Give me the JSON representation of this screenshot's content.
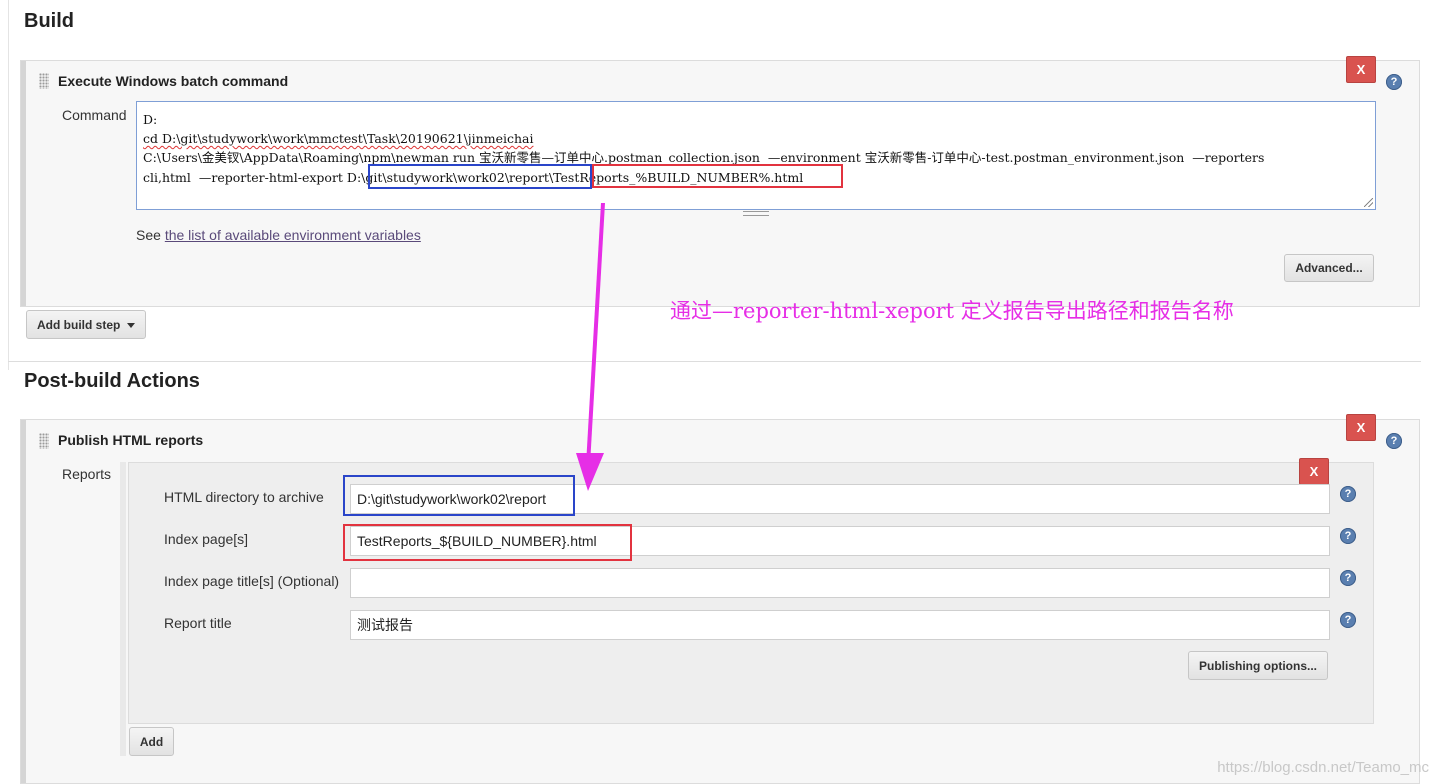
{
  "build": {
    "section_title": "Build",
    "step": {
      "title": "Execute Windows batch command",
      "close_label": "X",
      "command_label": "Command",
      "command_lines": [
        "D:",
        "cd D:\\git\\studywork\\work\\mmctest\\Task\\20190621\\jinmeichai",
        "C:\\Users\\金美钗\\AppData\\Roaming\\npm\\newman run 宝沃新零售—订单中心.postman_collection.json  —environment 宝沃新零售-订单中心-test.postman_environment.json  —reporters",
        "cli,html  —reporter-html-export D:\\git\\studywork\\work02\\report\\TestReports_%BUILD_NUMBER%.html"
      ],
      "see_prefix": "See ",
      "see_link": "the list of available environment variables",
      "advanced_label": "Advanced..."
    },
    "add_step_label": "Add build step"
  },
  "annotation_text": "通过—reporter-html-xeport 定义报告导出路径和报告名称",
  "post_build": {
    "section_title": "Post-build Actions",
    "step": {
      "title": "Publish HTML reports",
      "close_label": "X",
      "reports_label": "Reports",
      "entry_close_label": "X",
      "fields": [
        {
          "label": "HTML directory to archive",
          "value": "D:\\git\\studywork\\work02\\report"
        },
        {
          "label": "Index page[s]",
          "value": "TestReports_${BUILD_NUMBER}.html"
        },
        {
          "label": "Index page title[s] (Optional)",
          "value": ""
        },
        {
          "label": "Report title",
          "value": "测试报告"
        }
      ],
      "publishing_options_label": "Publishing options...",
      "add_label": "Add"
    }
  },
  "watermark": "https://blog.csdn.net/Teamo_mc",
  "colors": {
    "annotation": "#e62ee6",
    "box_blue": "#2a45c9",
    "box_red": "#e2333f",
    "close_button": "#d9534f"
  }
}
